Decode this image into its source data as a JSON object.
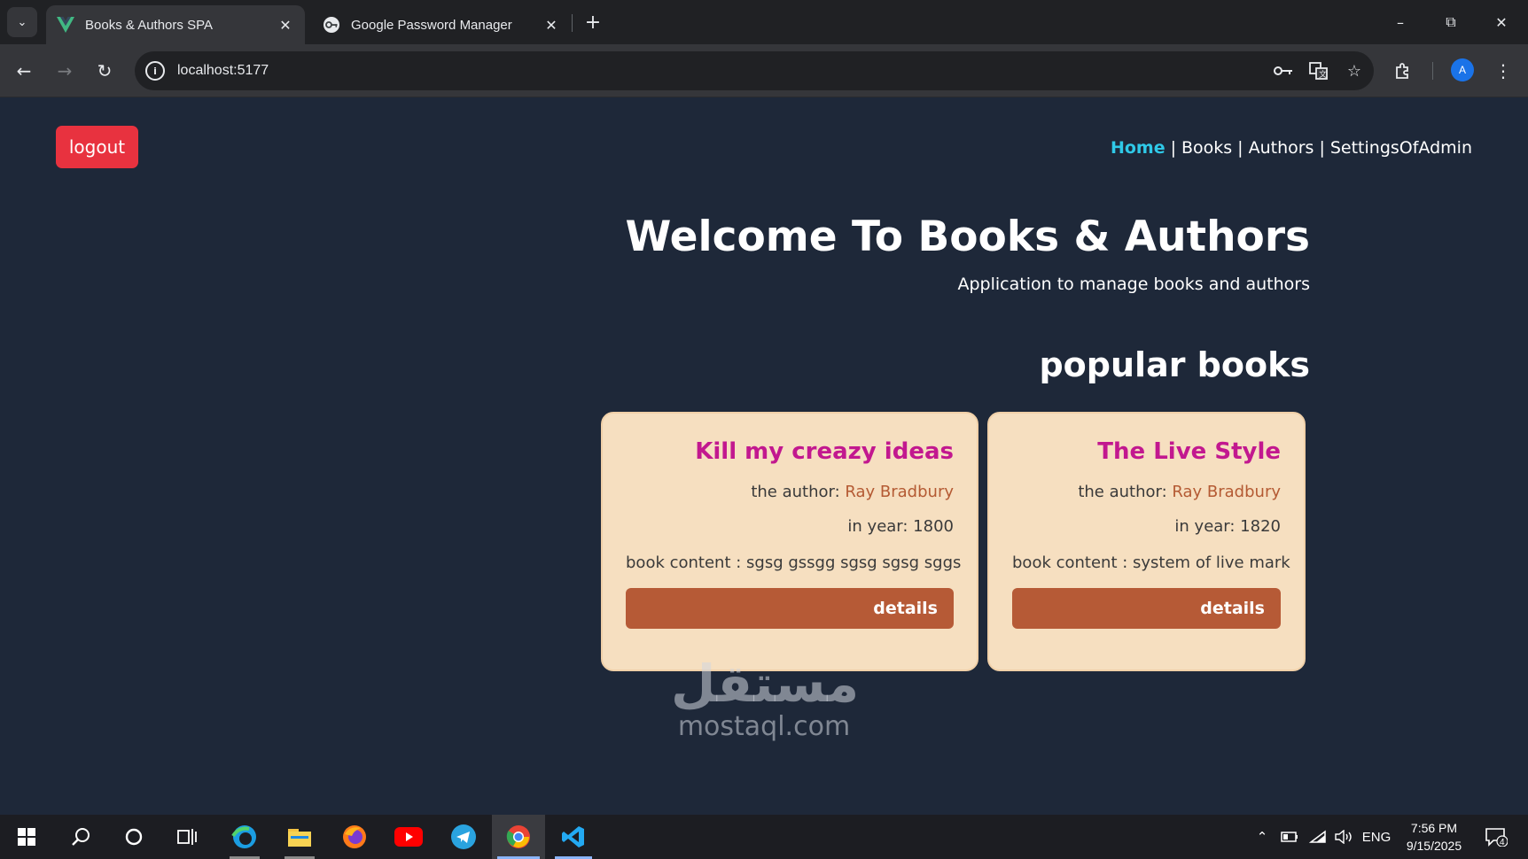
{
  "browser": {
    "tabs": [
      {
        "title": "Books & Authors SPA",
        "active": true,
        "favicon": "vue-logo-icon"
      },
      {
        "title": "Google Password Manager",
        "active": false,
        "favicon": "password-manager-icon"
      }
    ],
    "url": "localhost:5177",
    "profile_initial": "A"
  },
  "page": {
    "logout_label": "logout",
    "nav": {
      "home": "Home",
      "books": "Books",
      "authors": "Authors",
      "settings": "SettingsOfAdmin",
      "separator": "|"
    },
    "hero": {
      "title": "Welcome To Books & Authors",
      "subtitle": "Application to manage books and authors"
    },
    "section_title": "popular books",
    "books": [
      {
        "title": "Kill my creazy ideas",
        "author_label": "the author:",
        "author": "Ray Bradbury",
        "year_text": "in year: 1800",
        "content_text": "book content : sgsg gssgg sgsg sgsg sggs",
        "details_label": "details"
      },
      {
        "title": "The Live Style",
        "author_label": "the author:",
        "author": "Ray Bradbury",
        "year_text": "in year: 1820",
        "content_text": "book content : system of live mark",
        "details_label": "details"
      }
    ]
  },
  "watermark": {
    "arabic": "مستقل",
    "latin": "mostaql.com"
  },
  "taskbar": {
    "language": "ENG",
    "time": "7:56 PM",
    "date": "9/15/2025",
    "notification_count": "4"
  },
  "colors": {
    "page_bg": "#1e2839",
    "logout_red": "#e8323f",
    "nav_active": "#2fc9e8",
    "card_bg": "#f6dfc0",
    "book_title": "#c2188f",
    "author_name": "#b45a33",
    "details_button": "#b65a36"
  }
}
